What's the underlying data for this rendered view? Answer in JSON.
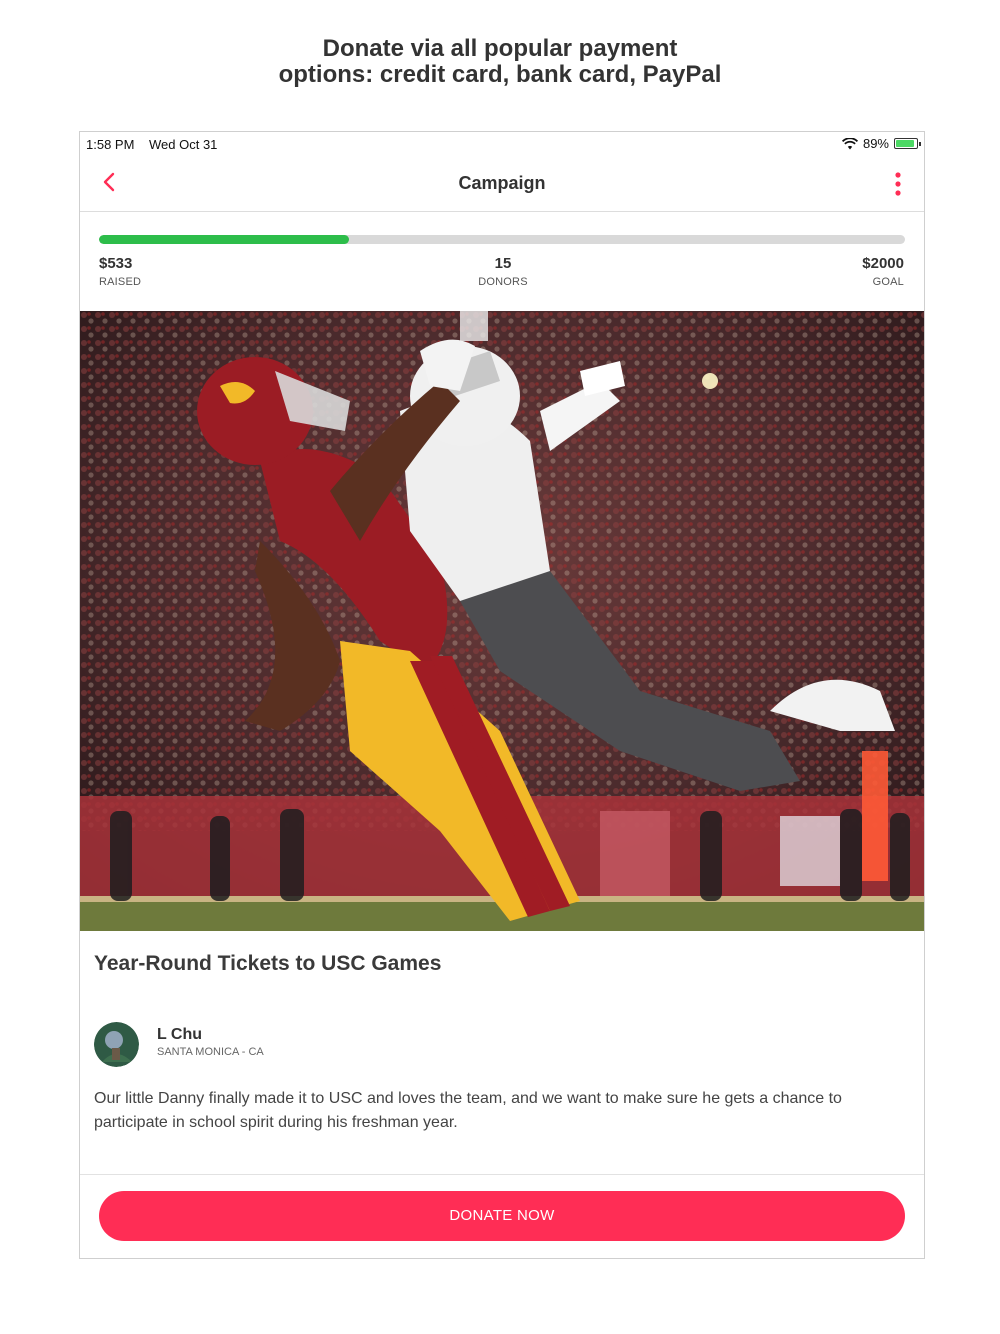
{
  "promo": {
    "line1": "Donate via all popular payment",
    "line2": "options: credit card, bank card, PayPal"
  },
  "status_bar": {
    "time": "1:58 PM",
    "date": "Wed Oct 31",
    "battery_percent": "89%",
    "battery_level": 0.89,
    "battery_charging": true
  },
  "nav": {
    "title": "Campaign",
    "back_icon": "chevron-left-icon",
    "menu_icon": "more-vertical-icon",
    "accent_color": "#ff2d55"
  },
  "progress": {
    "fraction": 0.31,
    "bar_color": "#2dbd4a",
    "raised_value": "$533",
    "raised_label": "RAISED",
    "donors_value": "15",
    "donors_label": "DONORS",
    "goal_value": "$2000",
    "goal_label": "GOAL"
  },
  "campaign": {
    "title": "Year-Round Tickets to USC Games",
    "organizer_name": "L Chu",
    "organizer_location": "SANTA MONICA - CA",
    "description": "Our little Danny finally made it to USC and loves the team, and we want to make sure he gets a chance to participate in school spirit during his freshman year."
  },
  "donate_button": {
    "label": "DONATE NOW",
    "color": "#ff2d55"
  }
}
